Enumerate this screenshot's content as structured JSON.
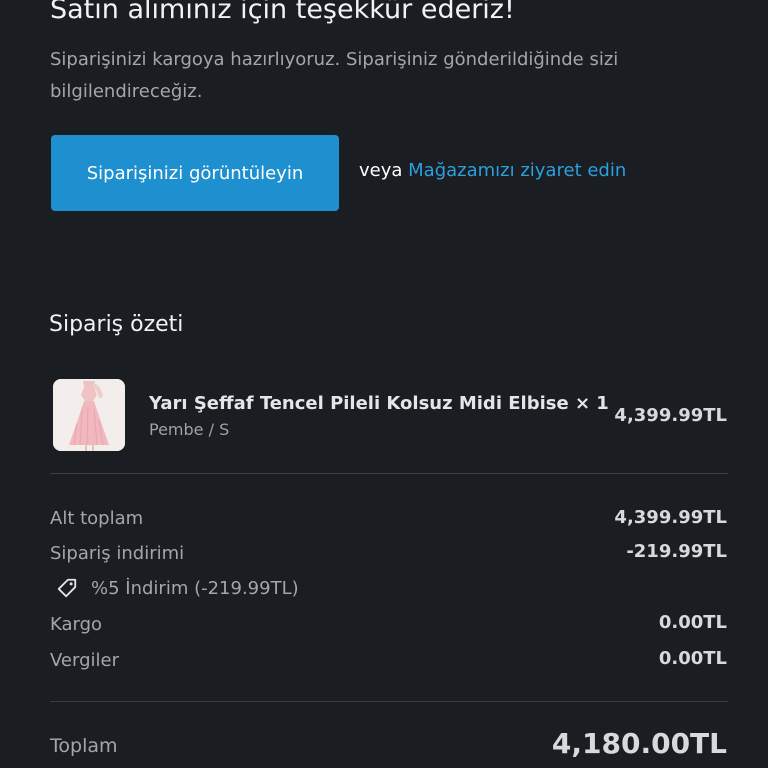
{
  "header": {
    "title": "Satın alımınız için teşekkür ederiz!",
    "subtitle": "Siparişinizi kargoya hazırlıyoruz. Siparişiniz gönderildiğinde sizi bilgilendireceğiz."
  },
  "actions": {
    "view_order_label": "Siparişinizi görüntüleyin",
    "or_text": "veya",
    "visit_store_label": "Mağazamızı ziyaret edin"
  },
  "summary": {
    "title": "Sipariş özeti",
    "product": {
      "name": "Yarı Şeffaf Tencel Pileli Kolsuz Midi Elbise × 1",
      "variant": "Pembe / S",
      "price": "4,399.99TL",
      "thumbnail_icon": "pink-dress-image"
    },
    "subtotal_label": "Alt toplam",
    "subtotal_value": "4,399.99TL",
    "discount_label": "Sipariş indirimi",
    "discount_value": "-219.99TL",
    "discount_code_icon": "tag-icon",
    "discount_code_text": "%5 İndirim (-219.99TL)",
    "shipping_label": "Kargo",
    "shipping_value": "0.00TL",
    "tax_label": "Vergiler",
    "tax_value": "0.00TL",
    "total_label": "Toplam",
    "total_value": "4,180.00TL"
  },
  "colors": {
    "background": "#1a1d21",
    "primary_button": "#1e90cf",
    "link": "#2aa0dd"
  }
}
